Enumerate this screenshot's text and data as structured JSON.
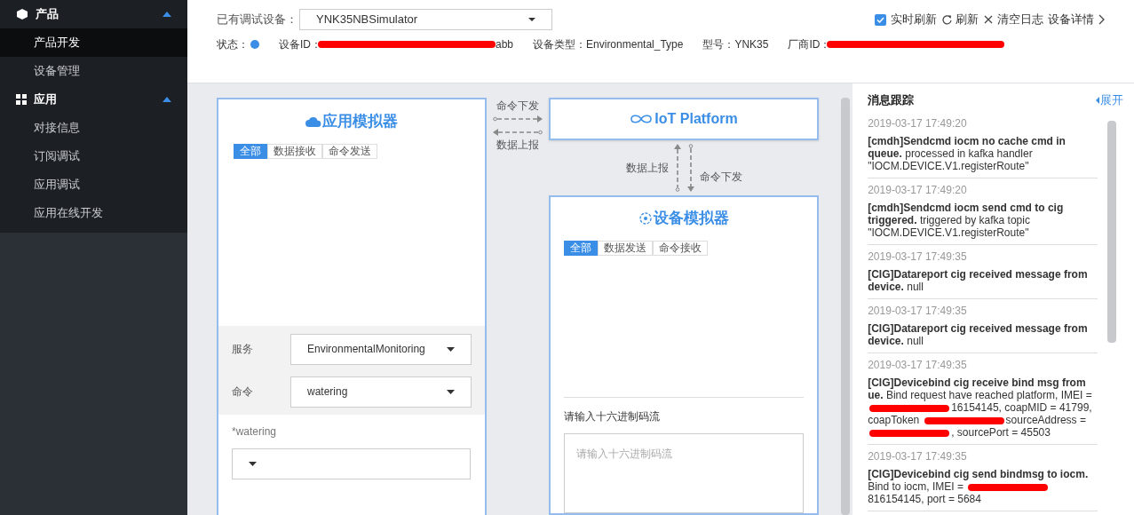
{
  "sidebar": {
    "groups": [
      {
        "label": "产品",
        "expanded": true,
        "items": [
          {
            "label": "产品开发",
            "selected": true
          },
          {
            "label": "设备管理",
            "selected": false
          }
        ]
      },
      {
        "label": "应用",
        "expanded": true,
        "items": [
          {
            "label": "对接信息",
            "selected": false
          },
          {
            "label": "订阅调试",
            "selected": false
          },
          {
            "label": "应用调试",
            "selected": false
          },
          {
            "label": "应用在线开发",
            "selected": false
          }
        ]
      }
    ]
  },
  "header": {
    "device_label": "已有调试设备：",
    "device_value": "YNK35NBSimulator",
    "realtime_refresh": {
      "label": "实时刷新",
      "checked": true
    },
    "refresh": "刷新",
    "clear_log": "清空日志",
    "details": "设备详情",
    "info": [
      {
        "kind": "status",
        "label": "状态：",
        "color": "#3b8ee6"
      },
      {
        "kind": "redacted",
        "label": "设备ID：",
        "tail": "abb"
      },
      {
        "kind": "text",
        "label": "设备类型：Environmental_Type"
      },
      {
        "kind": "text",
        "label": "型号：YNK35"
      },
      {
        "kind": "redacted",
        "label": "厂商ID："
      }
    ]
  },
  "app_simulator": {
    "title": "应用模拟器",
    "tabs": [
      {
        "label": "全部",
        "selected": true
      },
      {
        "label": "数据接收",
        "selected": false
      },
      {
        "label": "命令发送",
        "selected": false
      }
    ],
    "service": {
      "label": "服务",
      "value": "EnvironmentalMonitoring"
    },
    "command": {
      "label": "命令",
      "value": "watering"
    },
    "param_label": "*watering"
  },
  "links": {
    "top_down": "命令下发",
    "top_up": "数据上报",
    "right_up": "数据上报",
    "right_down": "命令下发"
  },
  "platform": {
    "title": "IoT Platform"
  },
  "device_simulator": {
    "title": "设备模拟器",
    "tabs": [
      {
        "label": "全部",
        "selected": true
      },
      {
        "label": "数据发送",
        "selected": false
      },
      {
        "label": "命令接收",
        "selected": false
      }
    ],
    "input_label": "请输入十六进制码流",
    "input_placeholder": "请输入十六进制码流"
  },
  "trace": {
    "title": "消息跟踪",
    "expand": "展开",
    "entries": [
      {
        "time": "2019-03-17 17:49:20",
        "head": "[cmdh]Sendcmd iocm no cache cmd in queue.",
        "body": [
          {
            "text": "processed in kafka handler \"IOCM.DEVICE.V1.registerRoute\""
          }
        ]
      },
      {
        "time": "2019-03-17 17:49:20",
        "head": "[cmdh]Sendcmd iocm send cmd to cig triggered.",
        "body": [
          {
            "text": "triggered by kafka topic \"IOCM.DEVICE.V1.registerRoute\""
          }
        ]
      },
      {
        "time": "2019-03-17 17:49:35",
        "head": "[CIG]Datareport cig received message from device.",
        "body": [
          {
            "text": "null"
          }
        ]
      },
      {
        "time": "2019-03-17 17:49:35",
        "head": "[CIG]Datareport cig received message from device.",
        "body": [
          {
            "text": "null"
          }
        ]
      },
      {
        "time": "2019-03-17 17:49:35",
        "head": "[CIG]Devicebind cig receive bind msg from ue.",
        "body": [
          {
            "text": "Bind request have reached platform, IMEI ="
          },
          {
            "kind": "redaction"
          },
          {
            "text": "16154145, coapMID = 41799, coapToken"
          },
          {
            "kind": "redaction"
          },
          {
            "text": "sourceAddress ="
          },
          {
            "kind": "redaction"
          },
          {
            "text": ", sourcePort = 45503"
          }
        ]
      },
      {
        "time": "2019-03-17 17:49:35",
        "head": "[CIG]Devicebind cig send bindmsg to iocm.",
        "body": [
          {
            "text": "Bind to iocm, IMEI ="
          },
          {
            "kind": "redaction"
          },
          {
            "text": "816154145, port = 5684"
          }
        ]
      }
    ]
  }
}
